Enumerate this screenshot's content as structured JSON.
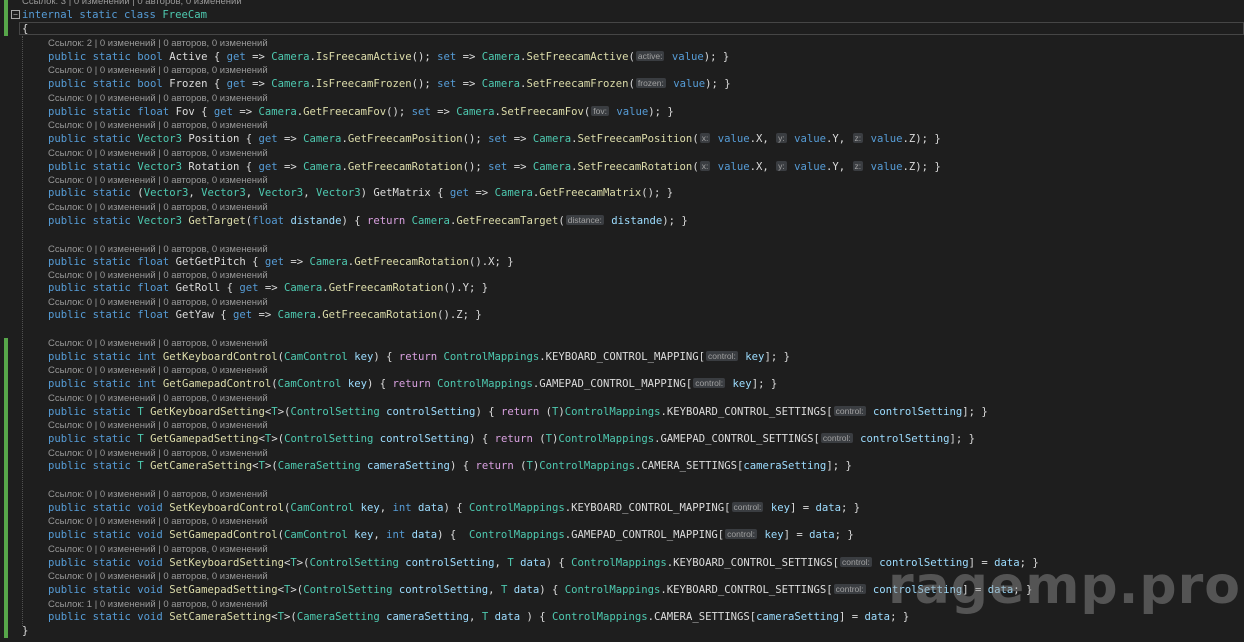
{
  "editor": {
    "language": "C#",
    "watermark": "ragemp.pro",
    "colors": {
      "background": "#1e1e1e",
      "keyword": "#569cd6",
      "control_keyword": "#d8a0df",
      "type": "#4ec9b0",
      "method": "#dcdcaa",
      "parameter": "#9cdcfe",
      "plain": "#dcdcdc",
      "codelens": "#999999",
      "modified_bar": "#57a64a"
    },
    "lens": {
      "class": "Ссылок: 3 | 0 изменений | 0 авторов, 0 изменений",
      "active": "Ссылок: 2 | 0 изменений | 0 авторов, 0 изменений",
      "default": "Ссылок: 0 | 0 изменений | 0 авторов, 0 изменений",
      "last": "Ссылок: 1 | 0 изменений | 0 авторов, 0 изменений"
    }
  }
}
